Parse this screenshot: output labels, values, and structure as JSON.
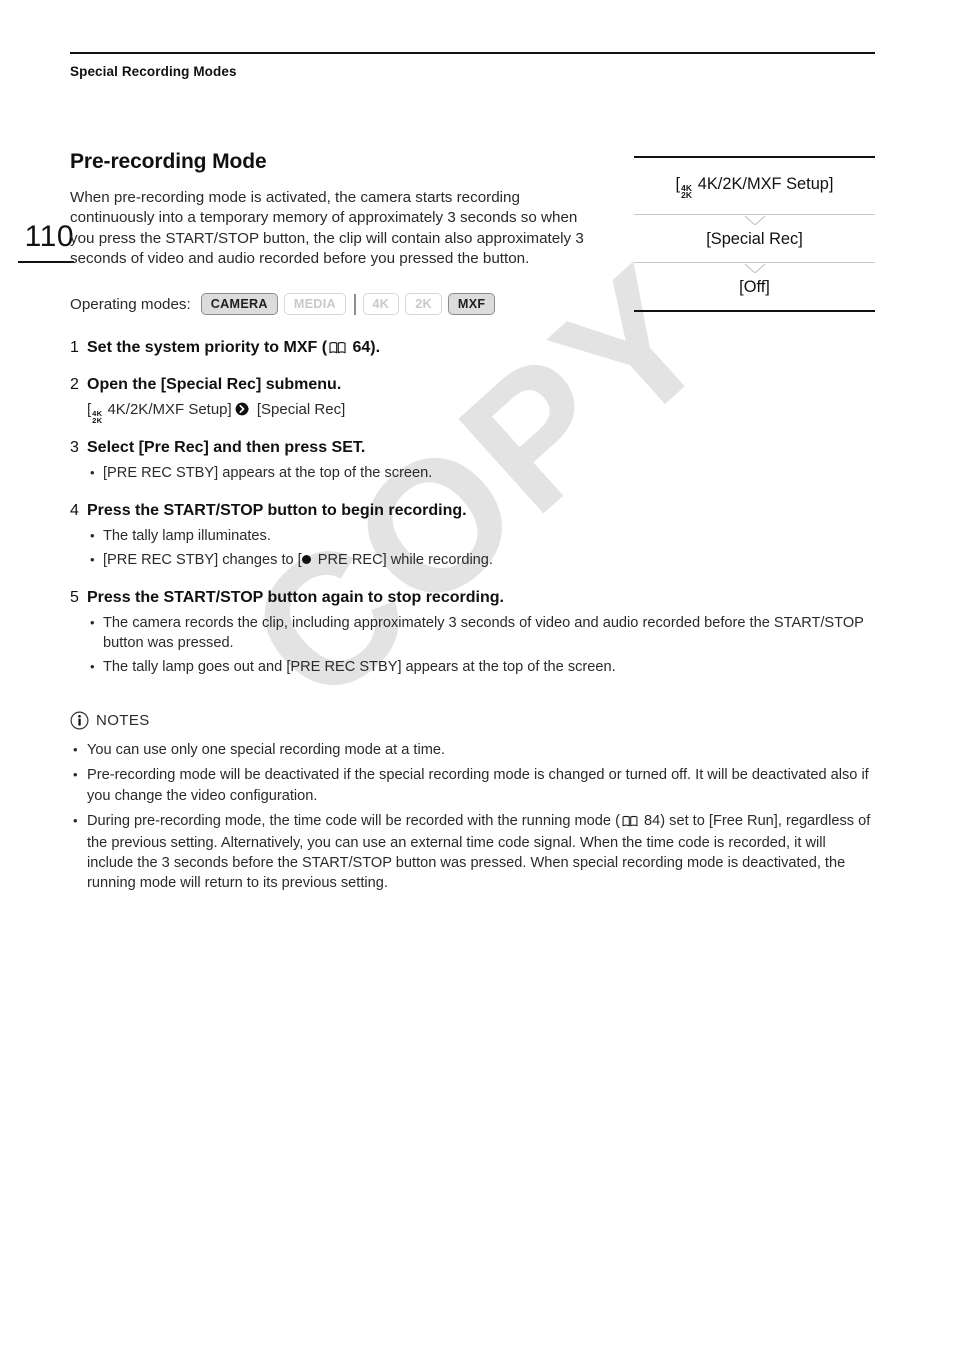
{
  "page": {
    "number": "110",
    "running_head": "Special Recording Modes",
    "watermark": "COPY"
  },
  "section": {
    "title": "Pre-recording Mode",
    "intro": "When pre-recording mode is activated, the camera starts recording continuously into a temporary memory of approximately 3 seconds so when you press the START/STOP button, the clip will contain also approximately 3 seconds of video and audio recorded before you pressed the button."
  },
  "operating_modes": {
    "label": "Operating modes:",
    "badges": [
      {
        "name": "CAMERA",
        "active": true
      },
      {
        "name": "MEDIA",
        "active": false
      },
      {
        "name": "4K",
        "active": false
      },
      {
        "name": "2K",
        "active": false
      },
      {
        "name": "MXF",
        "active": true
      }
    ]
  },
  "menu_box": {
    "items": [
      {
        "label": "[",
        "icon": "4k-2k-icon",
        "text": " 4K/2K/MXF Setup]",
        "full": "[ 4K/2K/MXF Setup]"
      },
      {
        "full": "[Special Rec]"
      },
      {
        "full": "[Off]"
      }
    ],
    "item1_prefix": "[",
    "item1_suffix": "4K/2K/MXF Setup]",
    "item2": "[Special Rec]",
    "item3": "[Off]"
  },
  "steps": [
    {
      "num": "1",
      "title_before": "Set the system priority to MXF (",
      "ref_icon": "book-icon",
      "ref_page": "64",
      "title_after": ").",
      "bullets": []
    },
    {
      "num": "2",
      "title": "Open the [Special Rec] submenu.",
      "path_prefix": "[",
      "path_icon": "4k-2k-icon",
      "path_first": "4K/2K/MXF Setup]",
      "path_arrow": "arrow-right-circle-icon",
      "path_second": "[Special Rec]",
      "bullets": []
    },
    {
      "num": "3",
      "title": "Select [Pre Rec] and then press SET.",
      "bullets": [
        "[PRE REC STBY] appears at the top of the screen."
      ]
    },
    {
      "num": "4",
      "title": "Press the START/STOP button to begin recording.",
      "bullets": [
        "The tally lamp illuminates."
      ],
      "bullet_rec_before": "[PRE REC STBY] changes to [",
      "bullet_rec_icon": "record-dot-icon",
      "bullet_rec_after": "PRE REC] while recording."
    },
    {
      "num": "5",
      "title": "Press the START/STOP button again to stop recording.",
      "bullets": [
        "The camera records the clip, including approximately 3 seconds of video and audio recorded before the START/STOP button was pressed.",
        "The tally lamp goes out and [PRE REC STBY] appears at the top of the screen."
      ]
    }
  ],
  "notes": {
    "icon": "info-circle-icon",
    "label": "NOTES",
    "items": [
      "You can use only one special recording mode at a time.",
      "Pre-recording mode will be deactivated if the special recording mode is changed or turned off. It will be deactivated also if you change the video configuration."
    ],
    "item3_before": "During pre-recording mode, the time code will be recorded with the running mode (",
    "item3_ref_icon": "book-icon",
    "item3_ref_page": "84",
    "item3_after": ") set to [Free Run], regardless of the previous setting. Alternatively, you can use an external time code signal. When the time code is recorded, it will include the 3 seconds before the START/STOP button was pressed. When special recording mode is deactivated, the running mode will return to its previous setting."
  },
  "colors": {
    "text": "#1a1a1a",
    "rule": "#111111",
    "badge_active_bg": "#dcdcdc",
    "badge_active_border": "#8d8d8d",
    "badge_inactive_text": "#c9c9c9",
    "watermark": "#e3e3e3"
  }
}
